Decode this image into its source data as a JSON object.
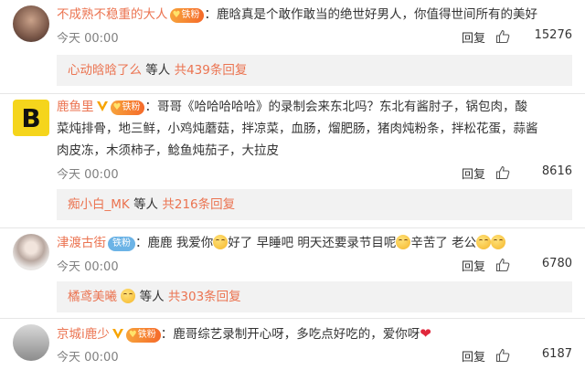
{
  "comments": [
    {
      "username": "不成熟不稳重的大人",
      "fan_badge": "铁粉",
      "text": "：鹿晗真是个敢作敢当的绝世好男人，你值得世间所有的美好",
      "time": "今天 00:00",
      "reply_label": "回复",
      "likes": "15276",
      "sub_reply_user": "心动晗晗了么",
      "sub_reply_middle": "等人",
      "sub_reply_count": "共439条回复"
    },
    {
      "username": "鹿鱼里",
      "fan_badge": "铁粉",
      "text_line1": "：哥哥《哈哈哈哈哈》的录制会来东北吗？东北有酱肘子，锅包肉，酸",
      "text_line2": "菜炖排骨，地三鲜，小鸡炖蘑菇，拌凉菜，血肠，熘肥肠，猪肉炖粉条，拌松花蛋，蒜酱",
      "text_line3": "肉皮冻，木须柿子，鲶鱼炖茄子，大拉皮",
      "time": "今天 00:00",
      "reply_label": "回复",
      "likes": "8616",
      "sub_reply_user": "痴小白_MK",
      "sub_reply_middle": "等人",
      "sub_reply_count": "共216条回复"
    },
    {
      "username": "津渡古街",
      "fan_badge": "铁粉",
      "text_a": "：鹿鹿 我爱你",
      "text_b": "好了 早睡吧 明天还要录节目呢",
      "text_c": "辛苦了 老公",
      "time": "今天 00:00",
      "reply_label": "回复",
      "likes": "6780",
      "sub_reply_user": "橘鸢美曦",
      "sub_reply_middle": "等人",
      "sub_reply_count": "共303条回复"
    },
    {
      "username": "京城i鹿少",
      "fan_badge": "铁粉",
      "text": "：鹿哥综艺录制开心呀，多吃点好吃的，爱你呀",
      "heart": "❤",
      "time": "今天 00:00",
      "reply_label": "回复",
      "likes": "6187"
    }
  ],
  "colors": {
    "username": "#eb7350",
    "reply_box_bg": "#f2f2f2",
    "divider": "#e6e6e6"
  }
}
